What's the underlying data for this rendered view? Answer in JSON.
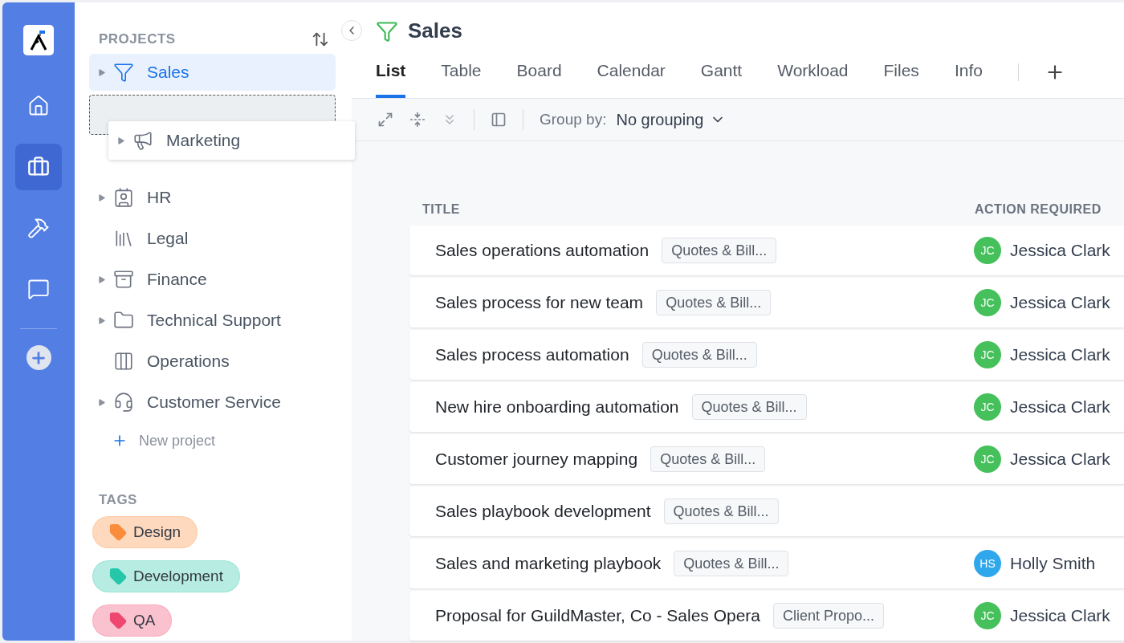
{
  "sidebar": {
    "heading": "PROJECTS",
    "projects": [
      {
        "label": "Sales",
        "expandable": true,
        "selected": true
      },
      {
        "label": "HR",
        "expandable": true,
        "selected": false
      },
      {
        "label": "Legal",
        "expandable": false,
        "selected": false
      },
      {
        "label": "Finance",
        "expandable": true,
        "selected": false
      },
      {
        "label": "Technical Support",
        "expandable": true,
        "selected": false
      },
      {
        "label": "Operations",
        "expandable": false,
        "selected": false
      },
      {
        "label": "Customer Service",
        "expandable": true,
        "selected": false
      }
    ],
    "dragging": {
      "label": "Marketing",
      "expandable": true
    },
    "new_project": "New project",
    "tags_heading": "TAGS",
    "tags": [
      {
        "label": "Design",
        "color": "#fb8c3c"
      },
      {
        "label": "Development",
        "color": "#26c6a9"
      },
      {
        "label": "QA",
        "color": "#ef4770"
      }
    ]
  },
  "page": {
    "title": "Sales",
    "tabs": [
      {
        "label": "List",
        "selected": true
      },
      {
        "label": "Table",
        "selected": false
      },
      {
        "label": "Board",
        "selected": false
      },
      {
        "label": "Calendar",
        "selected": false
      },
      {
        "label": "Gantt",
        "selected": false
      },
      {
        "label": "Workload",
        "selected": false
      },
      {
        "label": "Files",
        "selected": false
      },
      {
        "label": "Info",
        "selected": false
      }
    ],
    "group_by_label": "Group by:",
    "group_by_value": "No grouping"
  },
  "table": {
    "columns": [
      "TITLE",
      "ACTION REQUIRED"
    ],
    "rows": [
      {
        "title": "Sales operations automation",
        "tag": "Quotes & Bill...",
        "initials": "JC",
        "assignee": "Jessica Clark",
        "color": "#45c05b"
      },
      {
        "title": "Sales process for new team",
        "tag": "Quotes & Bill...",
        "initials": "JC",
        "assignee": "Jessica Clark",
        "color": "#45c05b"
      },
      {
        "title": "Sales process automation",
        "tag": "Quotes & Bill...",
        "initials": "JC",
        "assignee": "Jessica Clark",
        "color": "#45c05b"
      },
      {
        "title": "New hire onboarding automation",
        "tag": "Quotes & Bill...",
        "initials": "JC",
        "assignee": "Jessica Clark",
        "color": "#45c05b"
      },
      {
        "title": "Customer journey mapping",
        "tag": "Quotes & Bill...",
        "initials": "JC",
        "assignee": "Jessica Clark",
        "color": "#45c05b"
      },
      {
        "title": "Sales playbook development",
        "tag": "Quotes & Bill..."
      },
      {
        "title": "Sales and marketing playbook",
        "tag": "Quotes & Bill...",
        "initials": "HS",
        "assignee": "Holly Smith",
        "color": "#2ea7ec"
      },
      {
        "title": "Proposal for GuildMaster, Co - Sales Opera",
        "tag": "Client Propo...",
        "initials": "JC",
        "assignee": "Jessica Clark",
        "color": "#45c05b"
      }
    ]
  }
}
